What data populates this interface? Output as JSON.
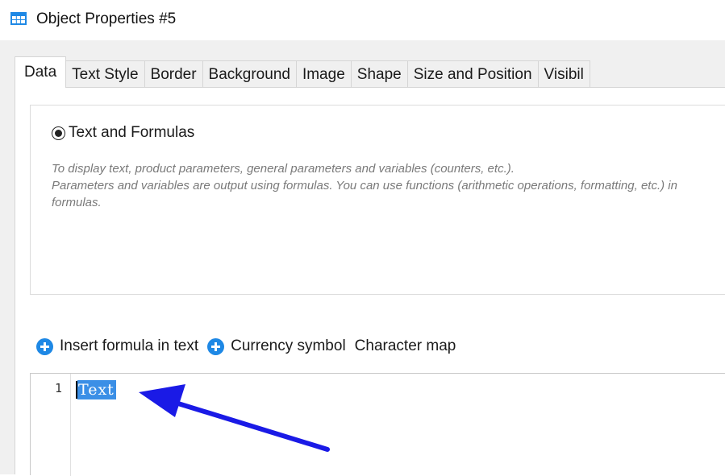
{
  "window": {
    "title": "Object Properties #5"
  },
  "tabs": [
    {
      "label": "Data",
      "active": true
    },
    {
      "label": "Text Style",
      "active": false
    },
    {
      "label": "Border",
      "active": false
    },
    {
      "label": "Background",
      "active": false
    },
    {
      "label": "Image",
      "active": false
    },
    {
      "label": "Shape",
      "active": false
    },
    {
      "label": "Size and Position",
      "active": false
    },
    {
      "label": "Visibil",
      "active": false
    }
  ],
  "mode": {
    "option_label": "Text and Formulas",
    "selected": true,
    "description_1": "To display text, product parameters, general parameters and variables (counters, etc.).",
    "description_2": "Parameters and variables are output using formulas. You can use functions (arithmetic operations, formatting, etc.) in formulas."
  },
  "toolbar": {
    "insert_formula_label": "Insert formula in text",
    "currency_symbol_label": "Currency symbol",
    "character_map_label": "Character map"
  },
  "editor": {
    "lines": [
      {
        "number": "1",
        "text": "Text",
        "selected": true
      }
    ]
  },
  "colors": {
    "accent": "#1e88e5",
    "selection": "#3b8fe6",
    "annotation_arrow": "#1a1ae6",
    "dialog_bg": "#f0f0f0"
  },
  "icons": {
    "title": "grid-table-icon",
    "insert_formula": "plus-circle-icon",
    "currency_symbol": "plus-circle-icon"
  }
}
